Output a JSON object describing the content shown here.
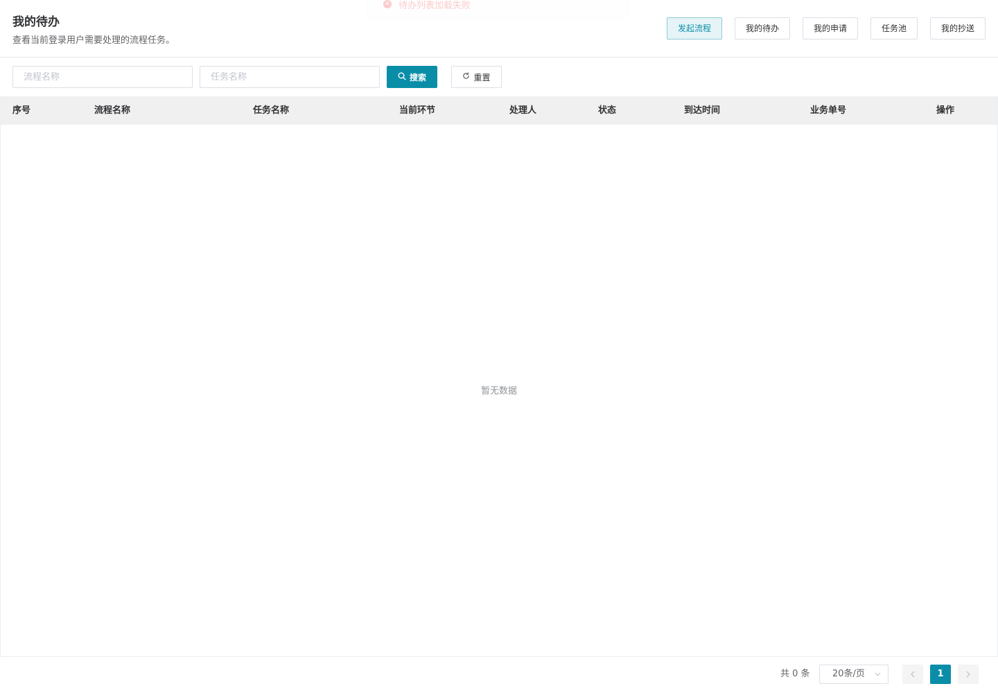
{
  "toast": {
    "text": "待办列表加载失败"
  },
  "header": {
    "title": "我的待办",
    "subtitle": "查看当前登录用户需要处理的流程任务。",
    "nav": [
      {
        "label": "发起流程"
      },
      {
        "label": "我的待办"
      },
      {
        "label": "我的申请"
      },
      {
        "label": "任务池"
      },
      {
        "label": "我的抄送"
      }
    ]
  },
  "search": {
    "process_placeholder": "流程名称",
    "task_placeholder": "任务名称",
    "search_label": "搜索",
    "reset_label": "重置"
  },
  "table": {
    "columns": [
      "序号",
      "流程名称",
      "任务名称",
      "当前环节",
      "处理人",
      "状态",
      "到达时间",
      "业务单号",
      "操作"
    ],
    "empty_text": "暂无数据"
  },
  "pagination": {
    "total_text": "共 0 条",
    "page_size": "20条/页",
    "current_page": "1"
  }
}
